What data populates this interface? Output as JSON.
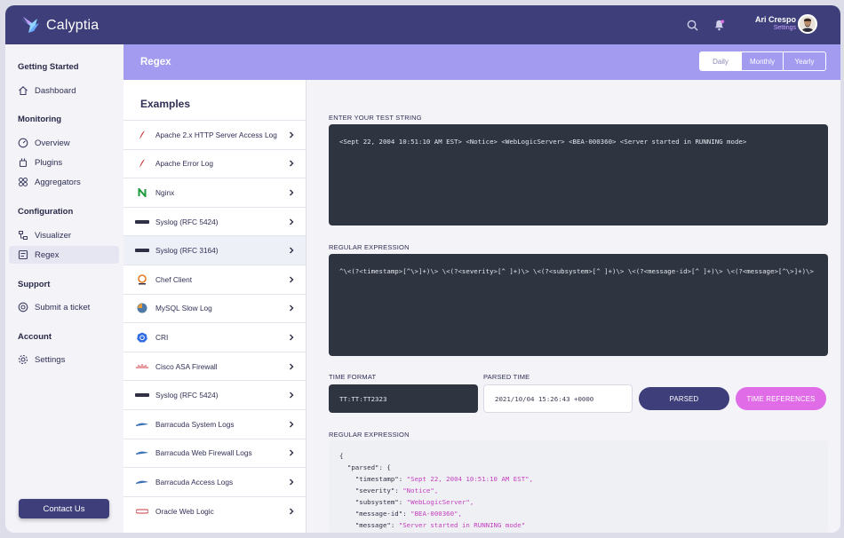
{
  "app": {
    "name": "Calyptia"
  },
  "user": {
    "name": "Ari Crespo",
    "settings_label": "Settings"
  },
  "icons": {
    "search": "search-icon",
    "notifications": "bell-icon"
  },
  "colors": {
    "topbar": "#3e3e7a",
    "accent": "#a29bf0",
    "pink": "#e06ce8",
    "code_bg": "#2e3440"
  },
  "sidebar": {
    "sections": [
      {
        "title": "Getting Started",
        "items": [
          {
            "label": "Dashboard",
            "icon": "home-icon"
          }
        ]
      },
      {
        "title": "Monitoring",
        "items": [
          {
            "label": "Overview",
            "icon": "gauge-icon"
          },
          {
            "label": "Plugins",
            "icon": "plugin-icon"
          },
          {
            "label": "Aggregators",
            "icon": "grid-icon"
          }
        ]
      },
      {
        "title": "Configuration",
        "items": [
          {
            "label": "Visualizer",
            "icon": "visualizer-icon"
          },
          {
            "label": "Regex",
            "icon": "regex-icon",
            "active": true
          }
        ]
      },
      {
        "title": "Support",
        "items": [
          {
            "label": "Submit a ticket",
            "icon": "lifebuoy-icon"
          }
        ]
      },
      {
        "title": "Account",
        "items": [
          {
            "label": "Settings",
            "icon": "gear-icon"
          }
        ]
      }
    ],
    "contact_label": "Contact Us"
  },
  "header": {
    "title": "Regex",
    "periods": [
      {
        "label": "Daily",
        "active": true
      },
      {
        "label": "Monthly"
      },
      {
        "label": "Yearly"
      }
    ]
  },
  "examples": {
    "title": "Examples",
    "items": [
      {
        "label": "Apache 2.x HTTP Server Access Log",
        "icon": "apache-feather-icon"
      },
      {
        "label": "Apache Error Log",
        "icon": "apache-feather-icon"
      },
      {
        "label": "Nginx",
        "icon": "nginx-icon"
      },
      {
        "label": "Syslog (RFC 5424)",
        "icon": "syslog-icon"
      },
      {
        "label": "Syslog (RFC 3164)",
        "icon": "syslog-icon",
        "active": true
      },
      {
        "label": "Chef Client",
        "icon": "chef-icon"
      },
      {
        "label": "MySQL Slow Log",
        "icon": "mysql-icon"
      },
      {
        "label": "CRI",
        "icon": "kubernetes-icon"
      },
      {
        "label": "Cisco ASA Firewall",
        "icon": "cisco-icon"
      },
      {
        "label": "Syslog (RFC 5424)",
        "icon": "syslog-icon"
      },
      {
        "label": "Barracuda System Logs",
        "icon": "barracuda-icon"
      },
      {
        "label": "Barracuda Web Firewall Logs",
        "icon": "barracuda-icon"
      },
      {
        "label": "Barracuda Access Logs",
        "icon": "barracuda-icon"
      },
      {
        "label": "Oracle Web Logic",
        "icon": "oracle-icon"
      }
    ]
  },
  "main": {
    "test_string_label": "ENTER YOUR TEST STRING",
    "test_string": "<Sept 22, 2004 10:51:10 AM EST> <Notice> <WebLogicServer> <BEA-000360> <Server started in RUNNING mode>",
    "regex_label": "REGULAR EXPRESSION",
    "regex": "^\\<(?<timestamp>[^\\>]+)\\> \\<(?<severity>[^ ]+)\\> \\<(?<subsystem>[^ ]+)\\> \\<(?<message-id>[^ ]+)\\> \\<(?<message>[^\\>]+)\\>",
    "time_format_label": "TIME FORMAT",
    "time_format": "TT:TT:TT2323",
    "parsed_time_label": "PARSED TIME",
    "parsed_time": "2021/10/04 15:26:43 +0000",
    "parsed_button": "PARSED",
    "time_references_button": "TIME REFERENCES",
    "output_label": "REGULAR EXPRESSION",
    "output": {
      "open": "{",
      "parsed_key": "\"parsed\": {",
      "fields": [
        {
          "key": "\"timestamp\"",
          "value": "\"Sept 22, 2004 10:51:10 AM EST\","
        },
        {
          "key": "\"severity\"",
          "value": "\"Notice\","
        },
        {
          "key": "\"subsystem\"",
          "value": "\"WebLogicServer\","
        },
        {
          "key": "\"message-id\"",
          "value": "\"BEA-000360\","
        },
        {
          "key": "\"message\"",
          "value": "\"Server started in RUNNING mode\""
        }
      ]
    }
  }
}
